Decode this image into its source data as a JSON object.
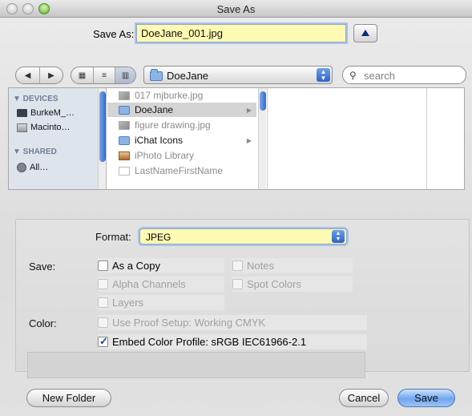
{
  "window": {
    "title": "Save As"
  },
  "save_as": {
    "label": "Save As:",
    "filename": "DoeJane_001.jpg"
  },
  "toolbar": {
    "back_glyph": "◀",
    "forward_glyph": "▶",
    "view_icon_glyph": "▦",
    "view_list_glyph": "≡",
    "view_column_glyph": "▥",
    "location": "DoeJane",
    "search_placeholder": "search"
  },
  "sidebar": {
    "devices_header": "▼ DEVICES",
    "devices": [
      {
        "label": "BurkeM_…"
      },
      {
        "label": "Macinto…"
      }
    ],
    "shared_header": "▼ SHARED",
    "shared": [
      {
        "label": "All…"
      }
    ]
  },
  "files": [
    {
      "name": "017 mjburke.jpg",
      "type": "img",
      "dim": true,
      "selected": false,
      "arrow": ""
    },
    {
      "name": "DoeJane",
      "type": "folder",
      "dim": false,
      "selected": true,
      "arrow": "▶"
    },
    {
      "name": "figure drawing.jpg",
      "type": "img",
      "dim": true,
      "selected": false,
      "arrow": ""
    },
    {
      "name": "iChat Icons",
      "type": "folder",
      "dim": false,
      "selected": false,
      "arrow": "▶"
    },
    {
      "name": "iPhoto Library",
      "type": "lib",
      "dim": true,
      "selected": false,
      "arrow": ""
    },
    {
      "name": "LastNameFirstName",
      "type": "doc",
      "dim": true,
      "selected": false,
      "arrow": ""
    }
  ],
  "options": {
    "format_label": "Format:",
    "format_value": "JPEG",
    "save_label": "Save:",
    "color_label": "Color:",
    "checkboxes": {
      "as_a_copy": {
        "label": "As a Copy",
        "checked": false
      },
      "notes": {
        "label": "Notes",
        "checked": false
      },
      "alpha_channels": {
        "label": "Alpha Channels",
        "checked": false
      },
      "spot_colors": {
        "label": "Spot Colors",
        "checked": false
      },
      "layers": {
        "label": "Layers",
        "checked": false
      },
      "use_proof_setup": {
        "label": "Use Proof Setup:  Working CMYK",
        "checked": false
      },
      "embed_color_profile": {
        "label": "Embed Color Profile:  sRGB IEC61966-2.1",
        "checked": true
      }
    }
  },
  "buttons": {
    "new_folder": "New Folder",
    "cancel": "Cancel",
    "save": "Save"
  }
}
